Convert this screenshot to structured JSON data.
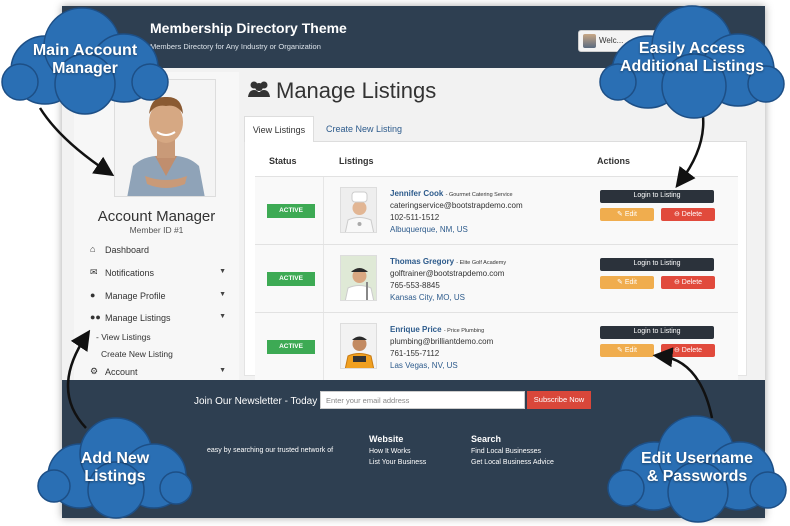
{
  "header": {
    "title": "Membership Directory Theme",
    "subtitle": "Members Directory for Any Industry or Organization",
    "welcome": "Welc..."
  },
  "sidebar": {
    "name": "Account Manager",
    "member_id": "Member ID #1",
    "items": [
      {
        "label": "Dashboard",
        "icon": "home-icon"
      },
      {
        "label": "Notifications",
        "icon": "envelope-icon"
      },
      {
        "label": "Manage Profile",
        "icon": "user-icon"
      },
      {
        "label": "Manage Listings",
        "icon": "users-icon"
      },
      {
        "label": "Account",
        "icon": "gear-icon"
      }
    ],
    "sub_items": [
      "- View Listings",
      "Create New Listing"
    ]
  },
  "main": {
    "title": "Manage Listings",
    "tabs": [
      "View Listings",
      "Create New Listing"
    ],
    "columns": [
      "Status",
      "Listings",
      "Actions"
    ],
    "listings": [
      {
        "status": "ACTIVE",
        "name": "Jennifer Cook",
        "tagline": "- Gourmet Catering Service",
        "email": "cateringservice@bootstrapdemo.com",
        "phone": "102-511-1512",
        "location": "Albuquerque, NM, US"
      },
      {
        "status": "ACTIVE",
        "name": "Thomas Gregory",
        "tagline": "- Elite Golf Academy",
        "email": "golftrainer@bootstrapdemo.com",
        "phone": "765-553-8845",
        "location": "Kansas City, MO, US"
      },
      {
        "status": "ACTIVE",
        "name": "Enrique Price",
        "tagline": "- Price Plumbing",
        "email": "plumbing@brilliantdemo.com",
        "phone": "761-155-7112",
        "location": "Las Vegas, NV, US"
      }
    ],
    "actions": {
      "login": "Login to Listing",
      "edit": "Edit",
      "delete": "Delete"
    }
  },
  "footer": {
    "newsletter_label": "Join Our Newsletter - Today",
    "email_placeholder": "Enter your email address",
    "subscribe": "Subscribe Now",
    "text": "easy by searching our trusted network of",
    "website_head": "Website",
    "website_links": [
      "How It Works",
      "List Your Business"
    ],
    "search_head": "Search",
    "search_links": [
      "Find Local Businesses",
      "Get Local Business Advice"
    ]
  },
  "callouts": {
    "main_account": [
      "Main Account",
      "Manager"
    ],
    "additional": [
      "Easily Access",
      "Additional Listings"
    ],
    "add_new": [
      "Add New",
      "Listings"
    ],
    "edit_user": [
      "Edit Username",
      "& Passwords"
    ]
  },
  "colors": {
    "header": "#2e3f51",
    "active": "#3daa54",
    "login": "#2b323b",
    "edit": "#f0ad4e",
    "delete": "#e14a3c",
    "link": "#2d5b8c",
    "cloud": "#2a6fb4"
  }
}
